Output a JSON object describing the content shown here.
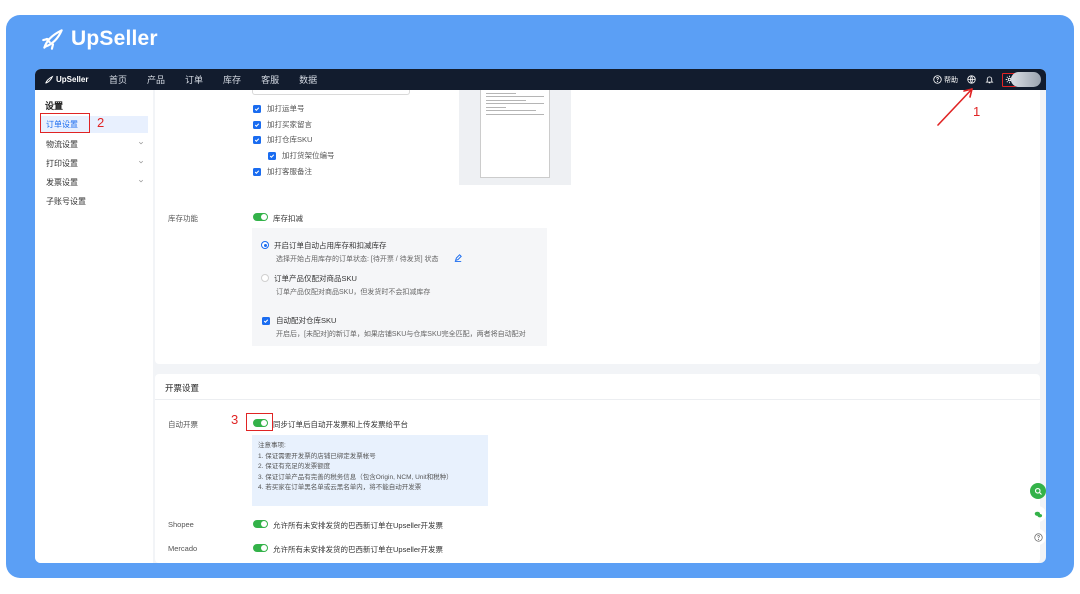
{
  "brand": {
    "name": "UpSeller"
  },
  "topbar": {
    "logo": "UpSeller",
    "nav": [
      "首页",
      "产品",
      "订单",
      "库存",
      "客服",
      "数据"
    ],
    "help_label": "帮助"
  },
  "sidebar": {
    "title": "设置",
    "items": [
      {
        "label": "订单设置",
        "active": true
      },
      {
        "label": "物流设置"
      },
      {
        "label": "打印设置"
      },
      {
        "label": "发票设置"
      },
      {
        "label": "子账号设置"
      }
    ]
  },
  "annotations": {
    "step1": "1",
    "step2": "2",
    "step3": "3",
    "color": "#e02424"
  },
  "print_options": {
    "items": [
      "加打运单号",
      "加打买家留言",
      "加打仓库SKU",
      "加打货架位编号",
      "加打客服备注"
    ]
  },
  "inventory": {
    "label": "库存功能",
    "toggle_label": "库存扣减",
    "option1_title": "开启订单自动占用库存和扣减库存",
    "option1_desc": "选择开始占用库存的订单状态: [待开票 / 待发货] 状态",
    "option2_title": "订单产品仅配对商品SKU",
    "option2_desc": "订单产品仅配对商品SKU，但发货时不会扣减库存",
    "auto_match_title": "自动配对仓库SKU",
    "auto_match_desc": "开启后，[未配对]的新订单，如果店铺SKU与仓库SKU完全匹配，两者将自动配对"
  },
  "invoice": {
    "section_title": "开票设置",
    "auto_label": "自动开票",
    "auto_toggle_text": "同步订单后自动开发票和上传发票给平台",
    "notice_title": "注意事项:",
    "notice_lines": [
      "1. 保证需要开发票的店铺已绑定发票帐号",
      "2. 保证有充足的发票额度",
      "3. 保证订单产品有完善的税务信息（包含Origin, NCM, Unit和税种）",
      "4. 若买家在订单黑名单或云黑名单内，将不能自动开发票"
    ],
    "shopee_label": "Shopee",
    "shopee_text": "允许所有未安排发货的巴西新订单在Upseller开发票",
    "mercado_label": "Mercado",
    "mercado_text": "允许所有未安排发货的巴西新订单在Upseller开发票"
  },
  "colors": {
    "accent": "#1a6cf0",
    "toggle_on": "#33b249",
    "topbar": "#121c2e",
    "frame": "#5b9ff5"
  }
}
